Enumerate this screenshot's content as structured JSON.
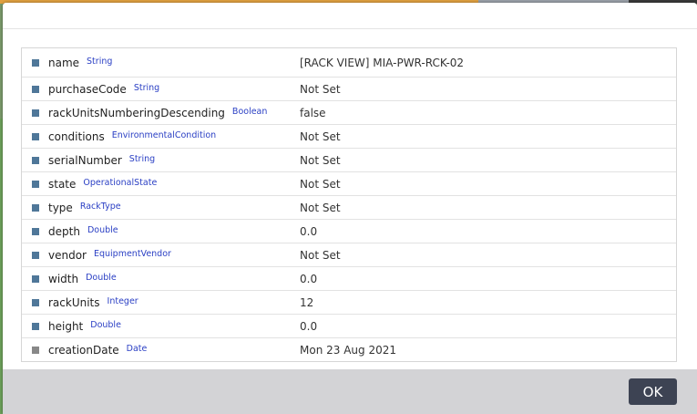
{
  "properties": [
    {
      "name": "name",
      "type": "String",
      "value": "[RACK VIEW] MIA-PWR-RCK-02"
    },
    {
      "name": "purchaseCode",
      "type": "String",
      "value": "Not Set"
    },
    {
      "name": "rackUnitsNumberingDescending",
      "type": "Boolean",
      "value": "false"
    },
    {
      "name": "conditions",
      "type": "EnvironmentalCondition",
      "value": "Not Set"
    },
    {
      "name": "serialNumber",
      "type": "String",
      "value": "Not Set"
    },
    {
      "name": "state",
      "type": "OperationalState",
      "value": "Not Set"
    },
    {
      "name": "type",
      "type": "RackType",
      "value": "Not Set"
    },
    {
      "name": "depth",
      "type": "Double",
      "value": "0.0"
    },
    {
      "name": "vendor",
      "type": "EquipmentVendor",
      "value": "Not Set"
    },
    {
      "name": "width",
      "type": "Double",
      "value": "0.0"
    },
    {
      "name": "rackUnits",
      "type": "Integer",
      "value": "12"
    },
    {
      "name": "height",
      "type": "Double",
      "value": "0.0"
    },
    {
      "name": "creationDate",
      "type": "Date",
      "value": "Mon 23 Aug 2021"
    }
  ],
  "footer": {
    "ok_label": "OK"
  }
}
